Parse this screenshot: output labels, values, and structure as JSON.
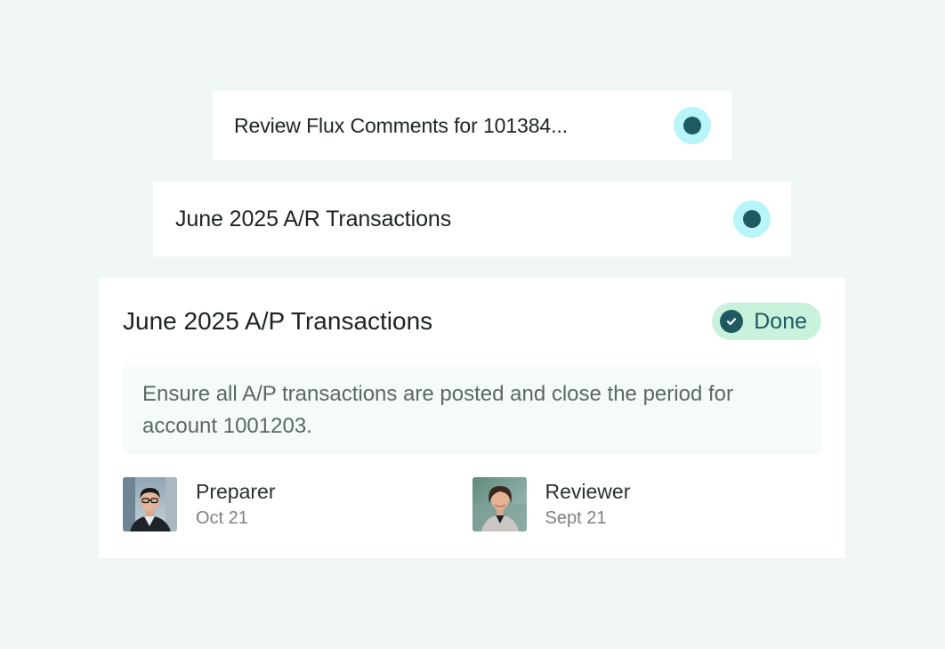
{
  "tasks": [
    {
      "title": "Review Flux Comments for 101384...",
      "status": "in-progress",
      "status_icon": "status-dot-icon"
    },
    {
      "title": "June 2025 A/R Transactions",
      "status": "in-progress",
      "status_icon": "status-dot-icon"
    }
  ],
  "detail": {
    "title": "June 2025 A/P Transactions",
    "badge": {
      "label": "Done",
      "icon": "check-circle-icon"
    },
    "description": "Ensure all A/P transactions are posted and close the period for account 1001203.",
    "preparer": {
      "role": "Preparer",
      "date": "Oct 21"
    },
    "reviewer": {
      "role": "Reviewer",
      "date": "Sept 21"
    }
  },
  "colors": {
    "background": "#f0f6f5",
    "card": "#ffffff",
    "accent_dark": "#1f5a63",
    "status_ring": "#b7f5f9",
    "done_badge_bg": "#c8f2dc",
    "description_bg": "#f5fbfb"
  }
}
